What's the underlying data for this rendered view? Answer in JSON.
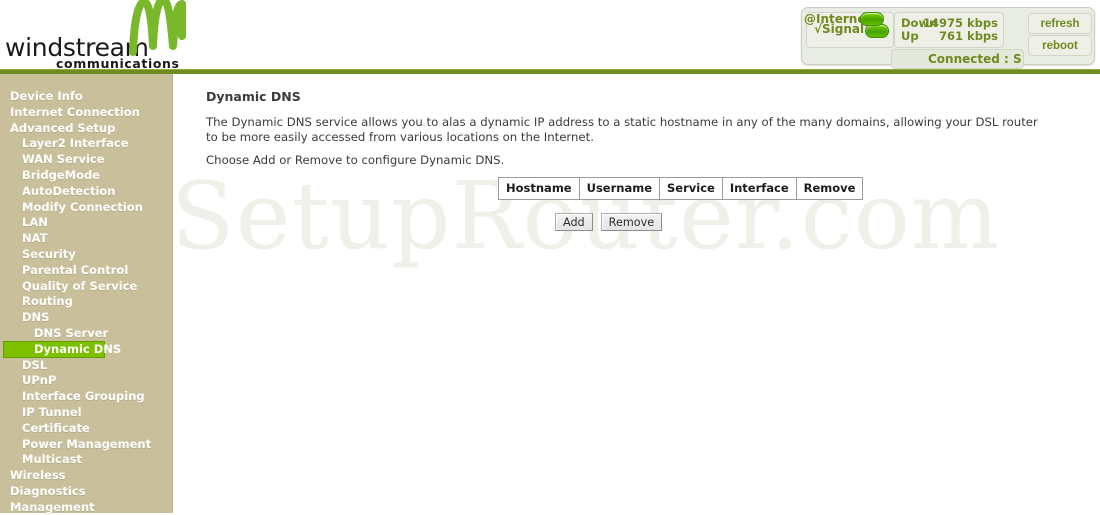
{
  "brand": {
    "wordmark": "windstream",
    "trademark": ".",
    "tagline": "communications"
  },
  "status": {
    "signal_label": "√Signal",
    "internet_label": "@Internet",
    "connected_text": "Connected : S",
    "rates": [
      {
        "name": "Down",
        "value": "14975 kbps"
      },
      {
        "name": "Up",
        "value": "761 kbps"
      }
    ],
    "refresh_label": "refresh",
    "reboot_label": "reboot",
    "led_color": "#5cb800",
    "text_color": "#6f8a1e"
  },
  "sidebar": {
    "background": "#c9bf9b",
    "active_color": "#7dc000",
    "items": [
      {
        "label": "Device Info",
        "level": 1,
        "active": false
      },
      {
        "label": "Internet Connection",
        "level": 1,
        "active": false
      },
      {
        "label": "Advanced Setup",
        "level": 1,
        "active": false
      },
      {
        "label": "Layer2 Interface",
        "level": 2,
        "active": false
      },
      {
        "label": "WAN Service",
        "level": 2,
        "active": false
      },
      {
        "label": "BridgeMode",
        "level": 2,
        "active": false
      },
      {
        "label": "AutoDetection",
        "level": 2,
        "active": false
      },
      {
        "label": "Modify Connection",
        "level": 2,
        "active": false
      },
      {
        "label": "LAN",
        "level": 2,
        "active": false
      },
      {
        "label": "NAT",
        "level": 2,
        "active": false
      },
      {
        "label": "Security",
        "level": 2,
        "active": false
      },
      {
        "label": "Parental Control",
        "level": 2,
        "active": false
      },
      {
        "label": "Quality of Service",
        "level": 2,
        "active": false
      },
      {
        "label": "Routing",
        "level": 2,
        "active": false
      },
      {
        "label": "DNS",
        "level": 2,
        "active": false
      },
      {
        "label": "DNS Server",
        "level": 3,
        "active": false
      },
      {
        "label": "Dynamic DNS",
        "level": 3,
        "active": true
      },
      {
        "label": "DSL",
        "level": 2,
        "active": false
      },
      {
        "label": "UPnP",
        "level": 2,
        "active": false
      },
      {
        "label": "Interface Grouping",
        "level": 2,
        "active": false
      },
      {
        "label": "IP Tunnel",
        "level": 2,
        "active": false
      },
      {
        "label": "Certificate",
        "level": 2,
        "active": false
      },
      {
        "label": "Power Management",
        "level": 2,
        "active": false
      },
      {
        "label": "Multicast",
        "level": 2,
        "active": false
      },
      {
        "label": "Wireless",
        "level": 1,
        "active": false
      },
      {
        "label": "Diagnostics",
        "level": 1,
        "active": false
      },
      {
        "label": "Management",
        "level": 1,
        "active": false
      }
    ]
  },
  "main": {
    "title": "Dynamic DNS",
    "description": "The Dynamic DNS service allows you to alas a dynamic IP address to a static hostname in any of the many domains, allowing your DSL router to be more easily accessed from various locations on the Internet.",
    "instruction": "Choose Add or Remove to configure Dynamic DNS.",
    "table": {
      "headers": [
        "Hostname",
        "Username",
        "Service",
        "Interface",
        "Remove"
      ],
      "rows": []
    },
    "buttons": [
      {
        "label": "Add"
      },
      {
        "label": "Remove"
      }
    ]
  },
  "watermark": {
    "text": "SetupRouter.com"
  }
}
